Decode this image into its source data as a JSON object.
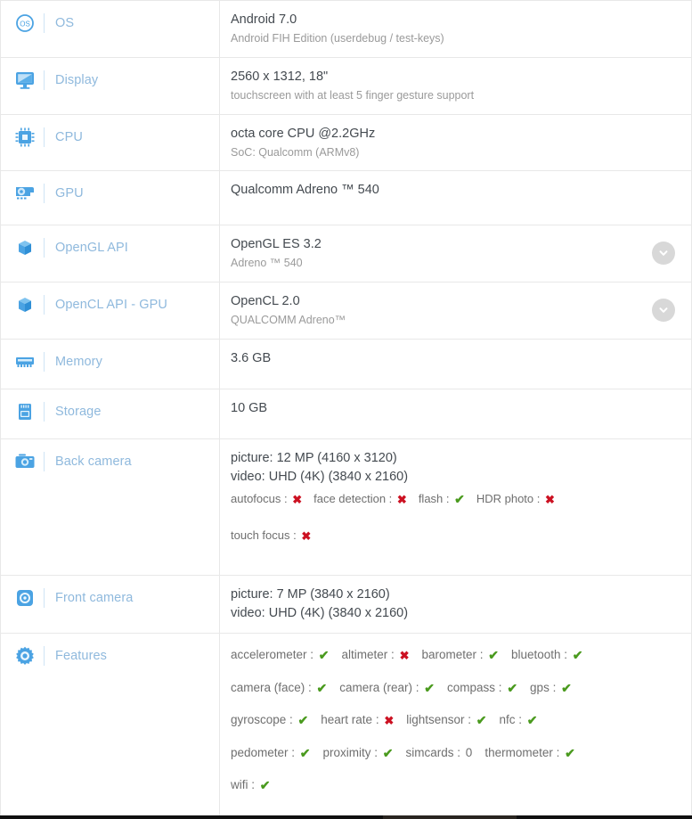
{
  "spec_rows": [
    {
      "id": "os",
      "icon": "os-circle-icon",
      "label": "OS",
      "primary": "Android 7.0",
      "secondary": "Android FIH Edition (userdebug / test-keys)"
    },
    {
      "id": "display",
      "icon": "monitor-icon",
      "label": "Display",
      "primary": "2560 x 1312, 18\"",
      "secondary": "touchscreen with at least 5 finger gesture support"
    },
    {
      "id": "cpu",
      "icon": "cpu-chip-icon",
      "label": "CPU",
      "primary": "octa core CPU @2.2GHz",
      "secondary": "SoC: Qualcomm (ARMv8)"
    },
    {
      "id": "gpu",
      "icon": "graphics-card-icon",
      "label": "GPU",
      "primary": "Qualcomm Adreno ™ 540",
      "secondary": ""
    },
    {
      "id": "opengl",
      "icon": "cube-icon",
      "label": "OpenGL API",
      "primary": "OpenGL ES 3.2",
      "secondary": "Adreno ™ 540",
      "has_expand": true
    },
    {
      "id": "opencl",
      "icon": "cube-icon",
      "label": "OpenCL API - GPU",
      "primary": "OpenCL 2.0",
      "secondary": "QUALCOMM Adreno™",
      "has_expand": true
    },
    {
      "id": "memory",
      "icon": "memory-chip-icon",
      "label": "Memory",
      "primary": "3.6 GB",
      "secondary": ""
    },
    {
      "id": "storage",
      "icon": "storage-card-icon",
      "label": "Storage",
      "primary": "10 GB",
      "secondary": ""
    }
  ],
  "back_camera": {
    "icon": "camera-icon",
    "label": "Back camera",
    "picture": "picture: 12 MP (4160 x 3120)",
    "video": "video: UHD (4K) (3840 x 2160)",
    "flag_lines": [
      [
        {
          "name": "autofocus :",
          "value": "no"
        },
        {
          "name": "face detection :",
          "value": "no"
        },
        {
          "name": "flash :",
          "value": "yes"
        },
        {
          "name": "HDR photo :",
          "value": "no"
        }
      ],
      [
        {
          "name": "touch focus :",
          "value": "no"
        }
      ]
    ]
  },
  "front_camera": {
    "icon": "front-camera-icon",
    "label": "Front camera",
    "picture": "picture: 7 MP (3840 x 2160)",
    "video": "video: UHD (4K) (3840 x 2160)"
  },
  "features": {
    "icon": "gear-icon",
    "label": "Features",
    "lines": [
      [
        {
          "name": "accelerometer :",
          "value": "yes"
        },
        {
          "name": "altimeter :",
          "value": "no"
        },
        {
          "name": "barometer :",
          "value": "yes"
        },
        {
          "name": "bluetooth :",
          "value": "yes"
        }
      ],
      [
        {
          "name": "camera (face) :",
          "value": "yes"
        },
        {
          "name": "camera (rear) :",
          "value": "yes"
        },
        {
          "name": "compass :",
          "value": "yes"
        },
        {
          "name": "gps :",
          "value": "yes"
        }
      ],
      [
        {
          "name": "gyroscope :",
          "value": "yes"
        },
        {
          "name": "heart rate :",
          "value": "no"
        },
        {
          "name": "lightsensor :",
          "value": "yes"
        },
        {
          "name": "nfc :",
          "value": "yes"
        }
      ],
      [
        {
          "name": "pedometer :",
          "value": "yes"
        },
        {
          "name": "proximity :",
          "value": "yes"
        },
        {
          "name": "simcards :",
          "value": "0"
        },
        {
          "name": "thermometer :",
          "value": "yes"
        }
      ],
      [
        {
          "name": "wifi :",
          "value": "yes"
        }
      ]
    ]
  },
  "marks": {
    "yes_glyph": "✔",
    "no_glyph": "✖"
  },
  "colors": {
    "label_blue": "#8fb9dd",
    "icon_blue": "#4ba3e3",
    "value_dark": "#444a50",
    "value_gray": "#9a9a9a",
    "check_green": "#4a9a1e",
    "cross_red": "#cc1122",
    "border": "#e8e8e8",
    "chevron_bg": "#d8d8d8"
  }
}
